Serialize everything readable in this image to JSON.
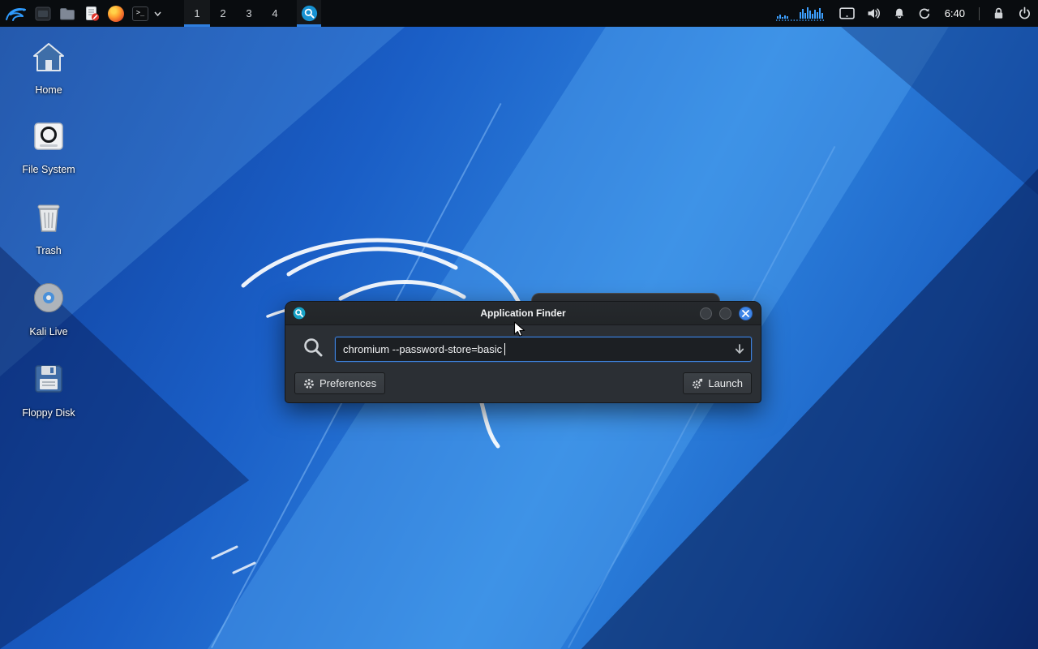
{
  "panel": {
    "workspaces": {
      "items": [
        "1",
        "2",
        "3",
        "4"
      ],
      "active": "1"
    },
    "terminal_glyph": ">_",
    "clock": "6:40"
  },
  "desktop": {
    "icons": [
      {
        "label": "Home"
      },
      {
        "label": "File System"
      },
      {
        "label": "Trash"
      },
      {
        "label": "Kali Live"
      },
      {
        "label": "Floppy Disk"
      }
    ]
  },
  "finder": {
    "title": "Application Finder",
    "query": "chromium --password-store=basic",
    "buttons": {
      "preferences": "Preferences",
      "launch": "Launch"
    }
  },
  "colors": {
    "accent": "#2f7fe0",
    "panel_bg": "#090c0f",
    "window_bg": "#2b2f34",
    "input_border": "#3f82d9",
    "close_button": "#3f86e8"
  }
}
